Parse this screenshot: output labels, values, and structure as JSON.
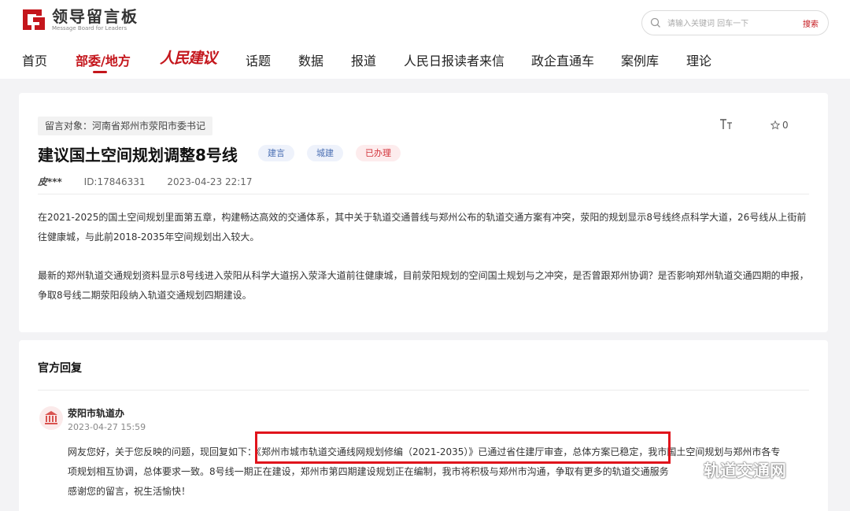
{
  "header": {
    "logo_title": "领导留言板",
    "logo_subtitle": "Message Board for Leaders",
    "search": {
      "placeholder": "请输入关键词 回车一下",
      "button": "搜索"
    }
  },
  "nav": {
    "items": [
      "首页",
      "部委/地方",
      "人民建议",
      "话题",
      "数据",
      "报道",
      "人民日报读者来信",
      "政企直通车",
      "案例库",
      "理论"
    ],
    "active_index": 1
  },
  "message": {
    "target": "留言对象：河南省郑州市荥阳市委书记",
    "font_icon": "TT",
    "favorites": "0",
    "title": "建议国土空间规划调整8号线",
    "badges": [
      "建言",
      "城建",
      "已办理"
    ],
    "author": "皮***",
    "id": "ID:17846331",
    "datetime": "2023-04-23 22:17",
    "paragraphs": [
      "在2021-2025的国土空间规划里面第五章，构建畅达高效的交通体系，其中关于轨道交通普线与郑州公布的轨道交通方案有冲突，荥阳的规划显示8号线终点科学大道，26号线从上街前往健康城，与此前2018-2035年空间规划出入较大。",
      "最新的郑州轨道交通规划资料显示8号线进入荥阳从科学大道拐入荥泽大道前往健康城，目前荥阳规划的空间国土规划与之冲突，是否曾跟郑州协调？是否影响郑州轨道交通四期的申报，争取8号线二期荥阳段纳入轨道交通规划四期建设。"
    ]
  },
  "reply": {
    "heading": "官方回复",
    "org": "荥阳市轨道办",
    "time": "2023-04-27 15:59",
    "lines": [
      "网友您好，关于您反映的问题，现回复如下：《郑州市城市轨道交通线网规划修编（2021-2035）》已通过省住建厅审查，总体方案已稳定，我市国土空间规划与郑州市各专",
      "项规划相互协调，总体要求一致。8号线一期正在建设，郑州市第四期建设规划正在编制，我市将积极与郑州市沟通，争取有更多的轨道交通服务",
      "感谢您的留言，祝生活愉快！"
    ]
  },
  "watermark": "轨道交通网",
  "colors": {
    "brand": "#c4161c",
    "highlight": "#e0141c",
    "badge_blue": "#4a6fb3",
    "badge_red": "#d2323a"
  }
}
